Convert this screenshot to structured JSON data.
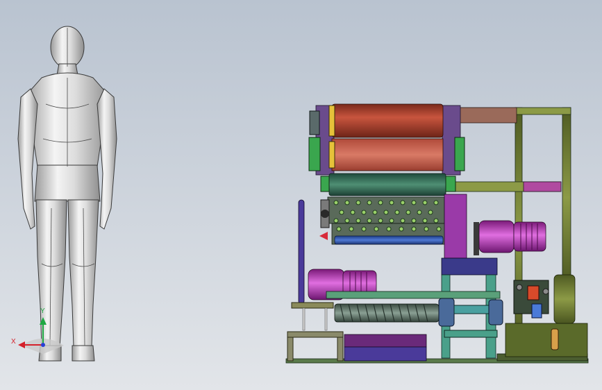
{
  "view": {
    "background_top": "#b9c3d0",
    "background_bottom": "#dde1e6"
  },
  "triad": {
    "x_label": "X",
    "y_label": "Y",
    "x_color": "#d4202a",
    "y_color": "#1fa843",
    "z_color": "#2a3fd6"
  },
  "scene": {
    "mannequin": "human-mannequin-back-view",
    "machine": "roller-machine-assembly"
  }
}
